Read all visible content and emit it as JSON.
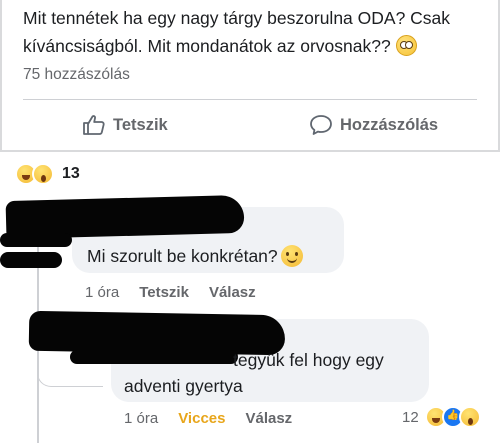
{
  "post": {
    "text_line1": "Mit tennétek ha egy nagy tárgy beszorulna ODA? Csak",
    "text_line2": "kíváncsiságból. Mit mondanátok az orvosnak??",
    "emoji": "flushed-face-icon",
    "comment_count": "75 hozzászólás"
  },
  "actions": {
    "like_label": "Tetszik",
    "comment_label": "Hozzászólás"
  },
  "reactions": {
    "icons": [
      "haha-reaction-icon",
      "wow-reaction-icon"
    ],
    "count": "13"
  },
  "comments": [
    {
      "author": "",
      "text": "Mi szorult be konkrétan?",
      "emoji": "smiling-face-icon",
      "time": "1 óra",
      "like_label": "Tetszik",
      "reply_label": "Válasz"
    },
    {
      "author": "",
      "text_line1": "tegyük fel hogy egy",
      "text_line2": "adventi gyertya",
      "time": "1 óra",
      "reaction_label": "Vicces",
      "reply_label": "Válasz",
      "reaction_count": "12",
      "reaction_icons": [
        "haha-reaction-icon",
        "like-reaction-icon",
        "wow-reaction-icon"
      ]
    }
  ],
  "colors": {
    "text": "#1c1e21",
    "muted": "#65676b",
    "bubble": "#f0f2f5",
    "funny_reaction": "#e8a61b",
    "like_blue": "#1a77f2"
  }
}
